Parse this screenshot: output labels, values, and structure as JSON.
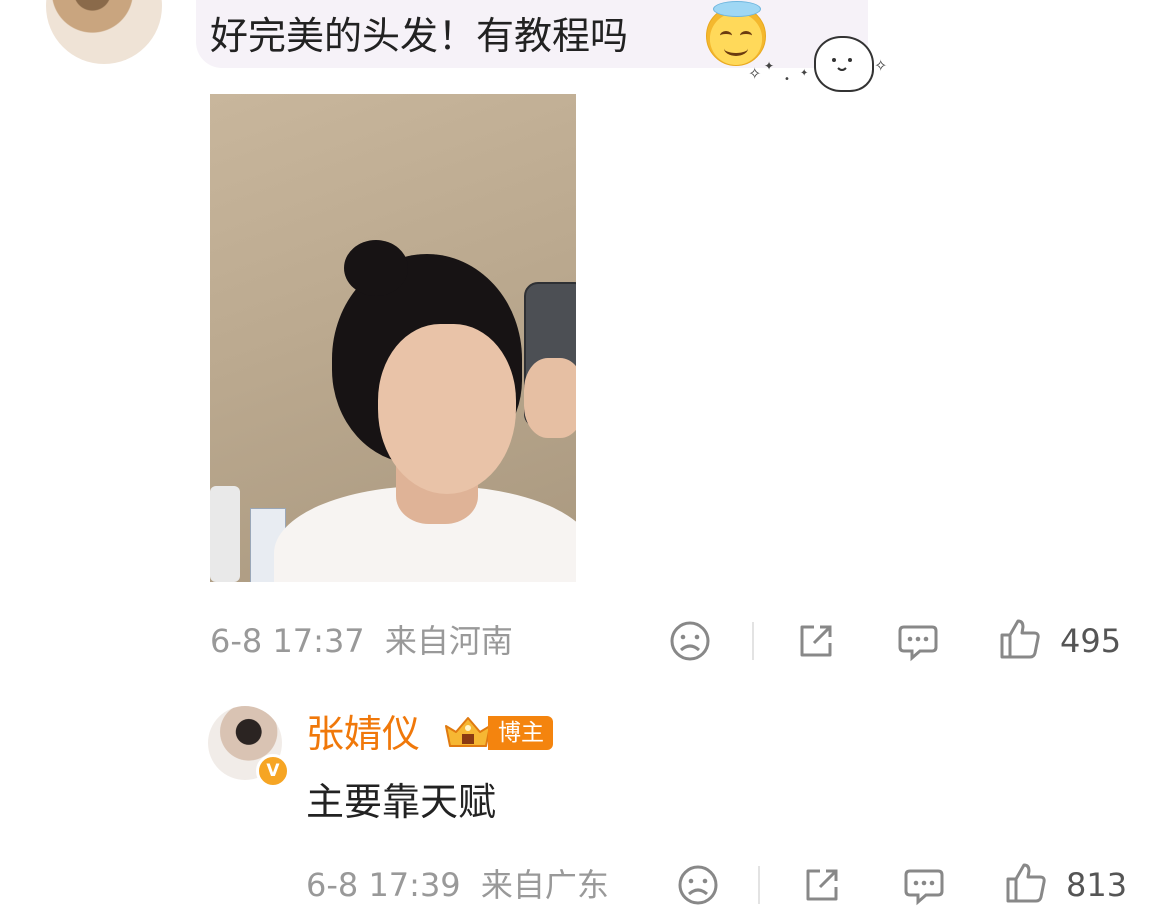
{
  "top_comment": {
    "text": "好完美的头发！有教程吗",
    "emoji_icon": "halo-smile-emoji-icon",
    "sticker_icon": "cloud-sticker-icon",
    "meta": {
      "time": "6-8 17:37",
      "location": "来自河南"
    },
    "actions": {
      "like_count": "495"
    }
  },
  "reply": {
    "author": "张婧仪",
    "badge_label": "博主",
    "verify_mark": "V",
    "text": "主要靠天赋",
    "meta": {
      "time": "6-8 17:39",
      "location": "来自广东"
    },
    "actions": {
      "like_count": "813"
    }
  },
  "icons": {
    "dislike": "sad-face-icon",
    "share": "share-icon",
    "comment": "comment-bubble-icon",
    "like": "thumbs-up-icon"
  },
  "colors": {
    "author_orange": "#f0780a",
    "badge_orange": "#f4840e",
    "meta_gray": "#999999",
    "icon_gray": "#888888",
    "bubble_bg": "#f6f2f8"
  }
}
